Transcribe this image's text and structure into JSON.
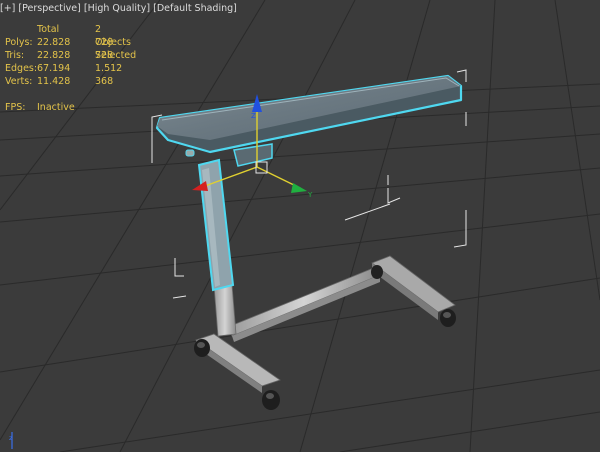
{
  "viewport": {
    "label_plus": "[+]",
    "label_view": "[Perspective]",
    "label_quality": "[High Quality]",
    "label_shading": "[Default Shading]"
  },
  "stats": {
    "headers": [
      "",
      "Total",
      "2 Objects Selected"
    ],
    "rows": [
      {
        "label": "Polys:",
        "total": "22.828",
        "selected": "728"
      },
      {
        "label": "Tris:",
        "total": "22.828",
        "selected": "728"
      },
      {
        "label": "Edges:",
        "total": "67.194",
        "selected": "1.512"
      },
      {
        "label": "Verts:",
        "total": "11.428",
        "selected": "368"
      }
    ],
    "fps_label": "FPS:",
    "fps_value": "Inactive"
  },
  "colors": {
    "background": "#3b3b3b",
    "stats_text": "#e3c34a",
    "selection_outline": "#4fd8f0",
    "gizmo_x": "#d42020",
    "gizmo_y": "#20b040",
    "gizmo_z": "#2050e0"
  },
  "icons": [
    "move-gizmo-icon",
    "world-axis-icon"
  ]
}
